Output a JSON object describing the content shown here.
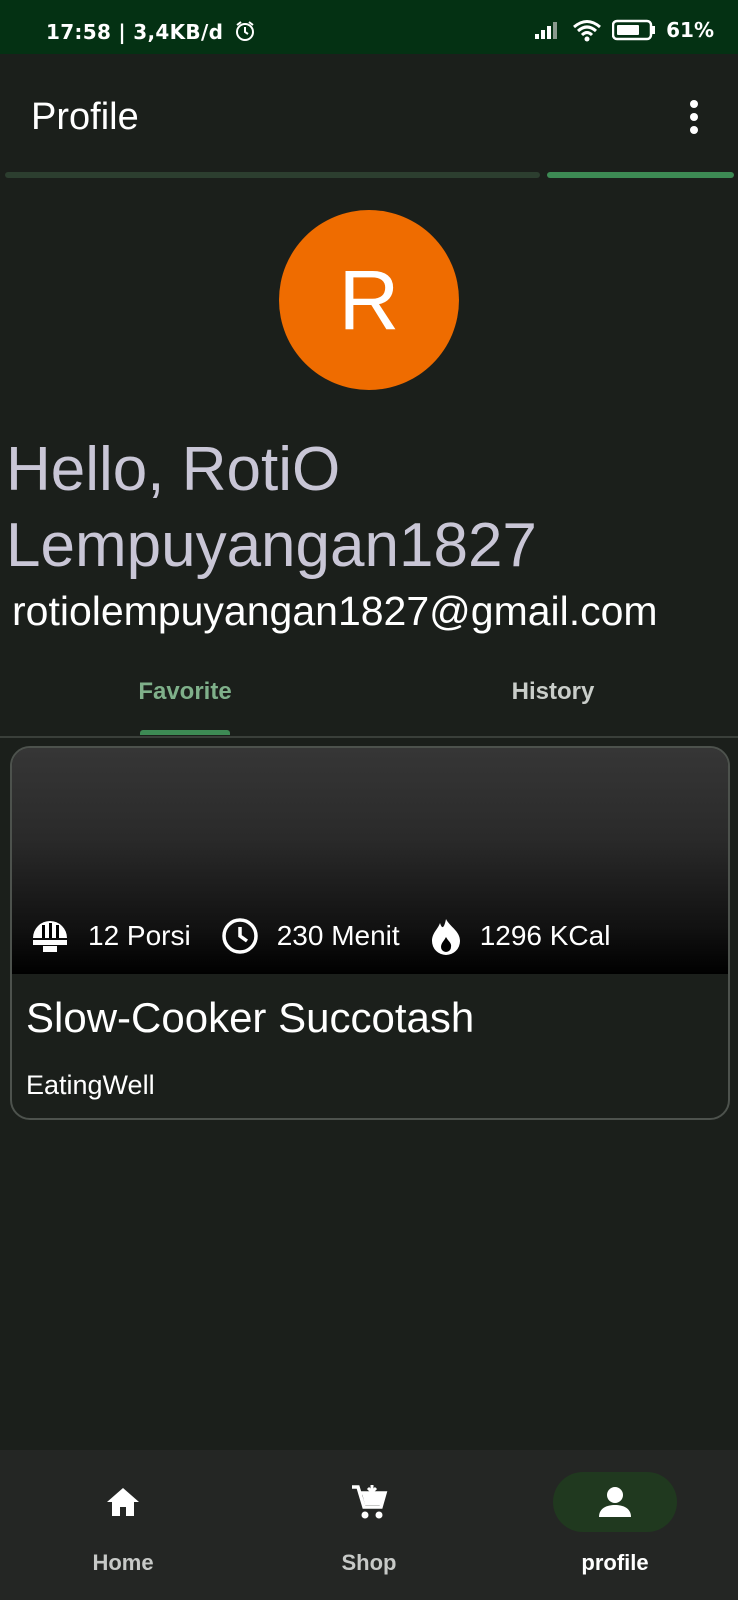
{
  "status_bar": {
    "time": "17:58 | 3,4KB/d",
    "battery": "61%"
  },
  "app_bar": {
    "title": "Profile"
  },
  "profile": {
    "avatar_letter": "R",
    "greeting": "Hello, RotiO Lempuyangan1827",
    "email": "rotiolempuyangan1827@gmail.com"
  },
  "tabs": [
    {
      "label": "Favorite",
      "selected": true
    },
    {
      "label": "History",
      "selected": false
    }
  ],
  "recipe_card": {
    "servings": "12 Porsi",
    "time": "230 Menit",
    "calories": "1296 KCal",
    "title": "Slow-Cooker Succotash",
    "source": "EatingWell"
  },
  "bottom_nav": [
    {
      "label": "Home",
      "icon": "home-icon"
    },
    {
      "label": "Shop",
      "icon": "cart-icon"
    },
    {
      "label": "profile",
      "icon": "person-icon",
      "selected": true
    }
  ],
  "colors": {
    "status_bar": "#043113",
    "background": "#1b1f1b",
    "accent": "#3d8a54",
    "avatar": "#ef6c00"
  }
}
